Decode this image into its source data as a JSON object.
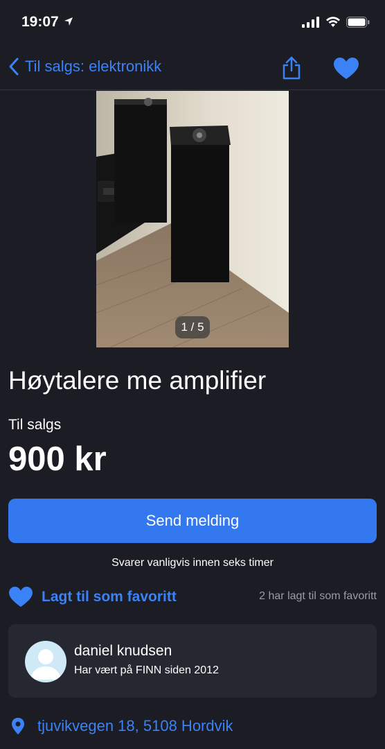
{
  "status": {
    "time": "19:07"
  },
  "nav": {
    "back_label": "Til salgs: elektronikk"
  },
  "photo": {
    "counter": "1 / 5"
  },
  "listing": {
    "title": "Høytalere me amplifier",
    "sale_label": "Til salgs",
    "price": "900 kr"
  },
  "actions": {
    "send_label": "Send melding",
    "response_note": "Svarer vanligvis innen seks timer",
    "favorite_label": "Lagt til som favoritt",
    "favorite_count": "2 har lagt til som favoritt"
  },
  "seller": {
    "name": "daniel knudsen",
    "since": "Har vært på FINN siden 2012"
  },
  "location": {
    "address": "tjuvikvegen 18, 5108 Hordvik"
  },
  "colors": {
    "accent": "#3b82f6",
    "background": "#1b1c24",
    "button": "#3478f0",
    "card": "#262831"
  }
}
